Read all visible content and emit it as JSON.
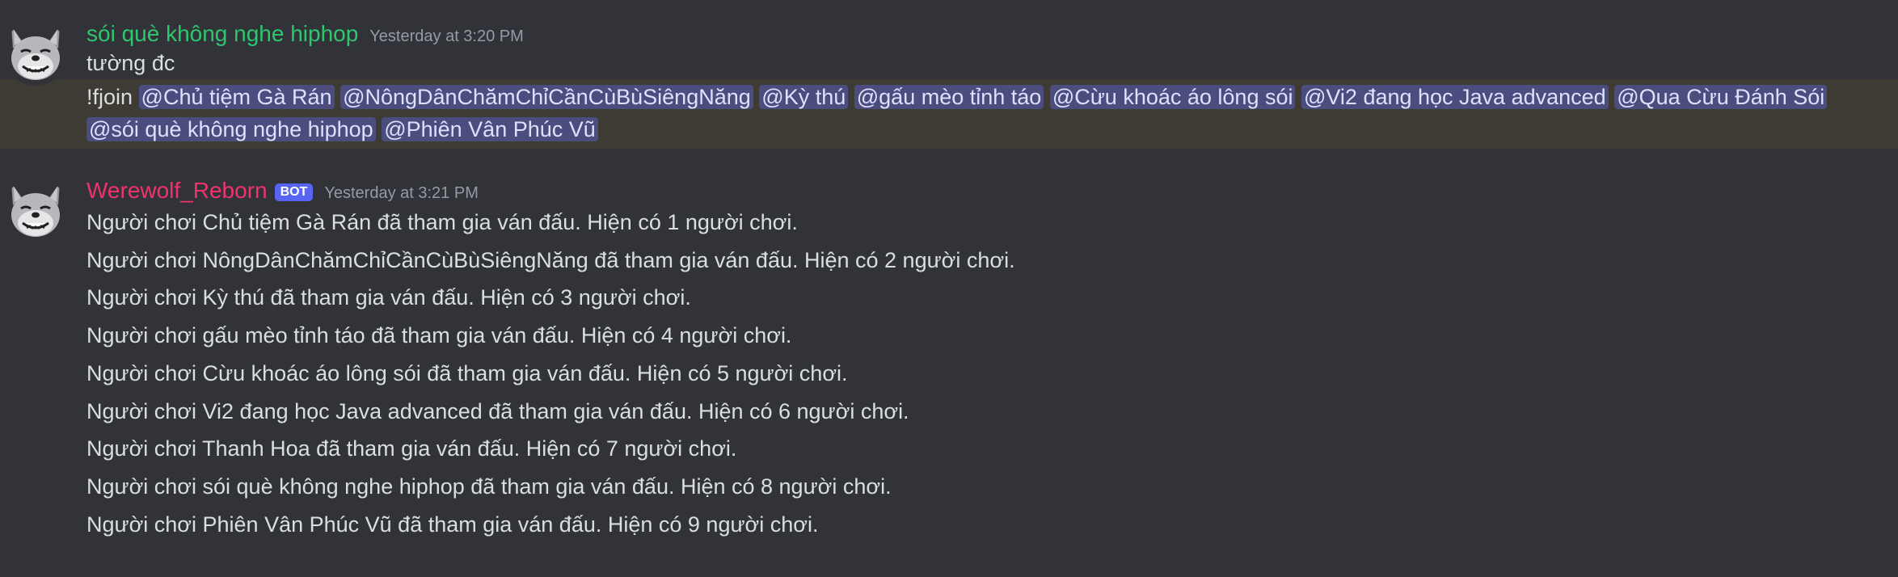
{
  "messages": [
    {
      "author": "sói què không nghe hiphop",
      "author_color": "#2dc770",
      "timestamp": "Yesterday at 3:20 PM",
      "avatar_icon": "wolf-avatar-icon",
      "lines": [
        "tường đc"
      ],
      "highlighted": {
        "prefix": "!fjoin ",
        "mentions": [
          "@Chủ tiệm Gà Rán",
          "@NôngDânChămChỉCầnCùBùSiêngNăng",
          "@Kỳ thú",
          "@gấu mèo tỉnh táo",
          "@Cừu khoác áo lông sói",
          "@Vi2 đang học Java advanced",
          "@Qua Cừu Đánh Sói",
          "@sói què không nghe hiphop",
          "@Phiên Vân Phúc Vũ"
        ]
      }
    },
    {
      "author": "Werewolf_Reborn",
      "author_color": "#f2326c",
      "bot_tag": "BOT",
      "timestamp": "Yesterday at 3:21 PM",
      "avatar_icon": "wolf-avatar-icon",
      "lines": [
        "Người chơi Chủ tiệm Gà Rán đã tham gia ván đấu. Hiện có 1 người chơi.",
        "Người chơi NôngDânChămChỉCầnCùBùSiêngNăng đã tham gia ván đấu. Hiện có 2 người chơi.",
        "Người chơi Kỳ thú đã tham gia ván đấu. Hiện có 3 người chơi.",
        "Người chơi gấu mèo tỉnh táo đã tham gia ván đấu. Hiện có 4 người chơi.",
        "Người chơi Cừu khoác áo lông sói đã tham gia ván đấu. Hiện có 5 người chơi.",
        "Người chơi Vi2 đang học Java advanced đã tham gia ván đấu. Hiện có 6 người chơi.",
        "Người chơi Thanh Hoa đã tham gia ván đấu. Hiện có 7 người chơi.",
        "Người chơi sói què không nghe hiphop đã tham gia ván đấu. Hiện có 8 người chơi.",
        "Người chơi Phiên Vân Phúc Vũ đã tham gia ván đấu. Hiện có 9 người chơi."
      ]
    }
  ]
}
